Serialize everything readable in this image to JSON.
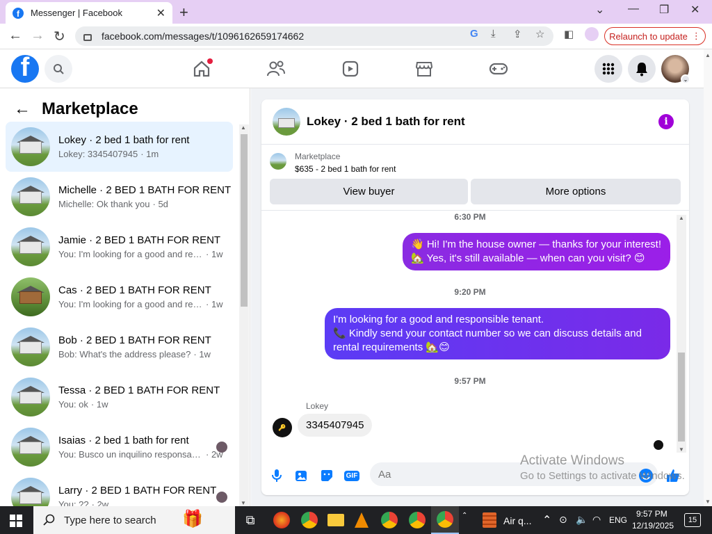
{
  "browser": {
    "tab_title": "Messenger | Facebook",
    "url": "facebook.com/messages/t/1096162659174662",
    "relaunch_label": "Relaunch to update"
  },
  "sidebar": {
    "title": "Marketplace",
    "conversations": [
      {
        "name": "Lokey · 2 bed 1 bath for rent",
        "preview": "Lokey: 3345407945",
        "age": "· 1m",
        "active": true
      },
      {
        "name": "Michelle · 2 BED 1 BATH FOR RENT",
        "preview": "Michelle: Ok thank you",
        "age": "· 5d"
      },
      {
        "name": "Jamie · 2 BED 1 BATH FOR RENT",
        "preview": "You: I'm looking for a good and responsible tenant",
        "age": "· 1w"
      },
      {
        "name": "Cas · 2 BED 1 BATH FOR RENT",
        "preview": "You: I'm looking for a good and responsible tenant",
        "age": "· 1w"
      },
      {
        "name": "Bob · 2 BED 1 BATH FOR RENT",
        "preview": "Bob: What's the address please?",
        "age": "· 1w"
      },
      {
        "name": "Tessa · 2 BED 1 BATH FOR RENT",
        "preview": "You: ok",
        "age": "· 1w"
      },
      {
        "name": "Isaias · 2 bed 1 bath for rent",
        "preview": "You: Busco un inquilino responsable",
        "age": "· 2w"
      },
      {
        "name": "Larry · 2 BED 1 BATH FOR RENT",
        "preview": "You: ??",
        "age": "· 2w"
      }
    ]
  },
  "chat": {
    "title": "Lokey · 2 bed 1 bath for rent",
    "marketplace_label": "Marketplace",
    "listing": "$635 - 2 bed 1 bath for rent",
    "view_buyer": "View buyer",
    "more_options": "More options",
    "ts1": "6:30 PM",
    "msg1_line1": "👋 Hi! I'm the house owner — thanks for your interest!",
    "msg1_line2": "🏡 Yes, it's still available — when can you visit? 😊",
    "ts2": "9:20 PM",
    "msg2_line1": "I'm looking for a good and responsible tenant.",
    "msg2_line2": "📞 Kindly send your contact number so we can discuss details and",
    "msg2_line3": "rental requirements 🏡😊",
    "ts3": "9:57 PM",
    "sender": "Lokey",
    "incoming": "3345407945",
    "input_placeholder": "Aa"
  },
  "watermark": {
    "line1": "Activate Windows",
    "line2": "Go to Settings to activate Windows."
  },
  "taskbar": {
    "search_placeholder": "Type here to search",
    "weather": "Air q...",
    "lang": "ENG",
    "time": "9:57 PM",
    "date": "12/19/2025",
    "notif_count": "15"
  },
  "colors": {
    "fb_blue": "#1877f2",
    "bubble_purple": "#9b1fe8",
    "info_purple": "#a000d8",
    "active_row": "#e7f3ff"
  }
}
